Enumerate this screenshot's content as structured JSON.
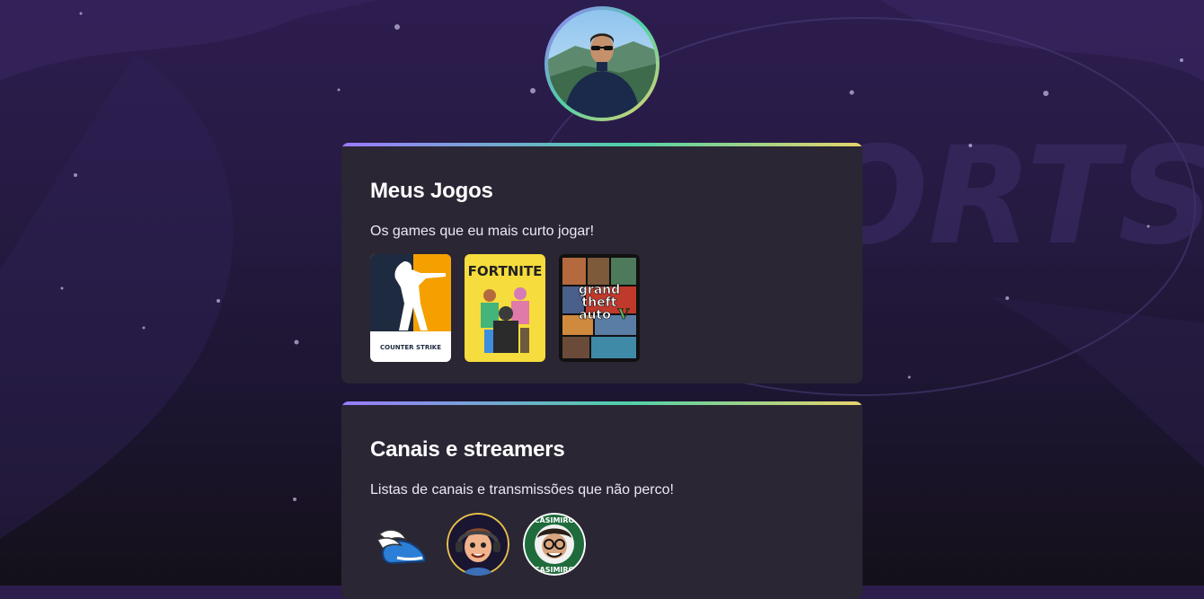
{
  "profile": {
    "avatar_icon": "profile-photo"
  },
  "games_section": {
    "title": "Meus Jogos",
    "description": "Os games que eu mais curto jogar!",
    "games": [
      {
        "name": "Counter-Strike",
        "icon": "counter-strike-cover",
        "logo_text": "COUNTER STRIKE"
      },
      {
        "name": "Fortnite",
        "icon": "fortnite-cover",
        "logo_text": "FORTNITE"
      },
      {
        "name": "Grand Theft Auto V",
        "icon": "gta-v-cover",
        "logo_text": "Grand Theft Auto"
      }
    ]
  },
  "channels_section": {
    "title": "Canais e streamers",
    "description": "Listas de canais e transmissões que não perco!",
    "channels": [
      {
        "icon": "winged-helmet-icon"
      },
      {
        "icon": "cartoon-streamer-avatar"
      },
      {
        "icon": "casimiro-logo",
        "logo_text": "CASIMIRO"
      }
    ]
  },
  "colors": {
    "background_top": "#2d1d4f",
    "card_bg": "#2a2634",
    "gradient_start": "#9b7bff",
    "gradient_mid": "#4fd1a8",
    "gradient_end": "#e8d46b"
  }
}
